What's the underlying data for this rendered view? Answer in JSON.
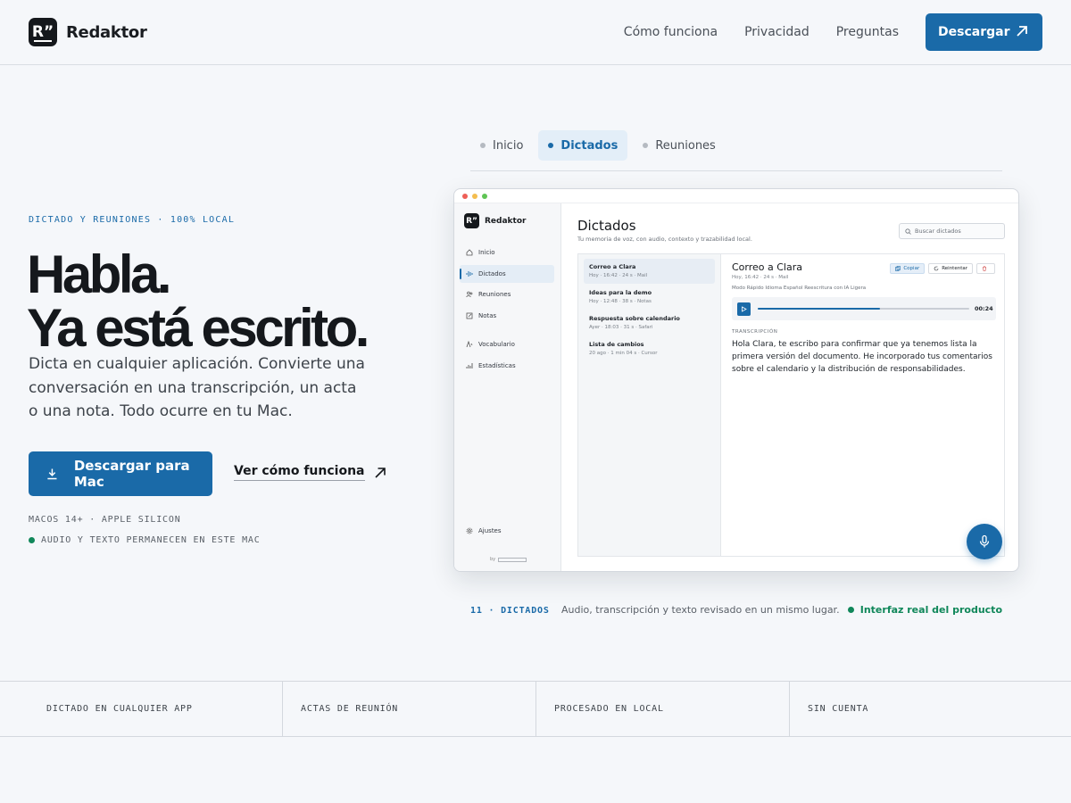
{
  "brand": {
    "name": "Redaktor",
    "mark": "R”"
  },
  "nav": {
    "links": [
      "Cómo funciona",
      "Privacidad",
      "Preguntas"
    ],
    "download_label": "Descargar"
  },
  "hero": {
    "eyebrow": "DICTADO Y REUNIONES · 100% LOCAL",
    "headline_1": "Habla.",
    "headline_2": "Ya está escrito.",
    "lede": "Dicta en cualquier aplicación. Convierte una conversación en una transcripción, un acta o una nota. Todo ocurre en tu Mac.",
    "cta_label": "Descargar para Mac",
    "secondary_label": "Ver cómo funciona",
    "meta_1": "MACOS 14+ · APPLE SILICON",
    "meta_2": "AUDIO Y TEXTO PERMANECEN EN ESTE MAC"
  },
  "tabs": [
    {
      "label": "Inicio",
      "active": false
    },
    {
      "label": "Dictados",
      "active": true
    },
    {
      "label": "Reuniones",
      "active": false
    }
  ],
  "app": {
    "brand": "Redaktor",
    "sidebar": {
      "items": [
        {
          "label": "Inicio",
          "icon": "home-icon"
        },
        {
          "label": "Dictados",
          "icon": "waveform-icon",
          "active": true
        },
        {
          "label": "Reuniones",
          "icon": "people-icon"
        },
        {
          "label": "Notas",
          "icon": "note-icon"
        },
        {
          "label": "Vocabulario",
          "icon": "vocabulary-icon"
        },
        {
          "label": "Estadísticas",
          "icon": "stats-icon"
        }
      ],
      "settings_label": "Ajustes",
      "by_label": "by"
    },
    "main": {
      "title": "Dictados",
      "subtitle": "Tu memoria de voz, con audio, contexto y trazabilidad local.",
      "search_placeholder": "Buscar dictados"
    },
    "list": [
      {
        "title": "Correo a Clara",
        "meta": "Hoy · 16:42 · 24 s · Mail",
        "active": true
      },
      {
        "title": "Ideas para la demo",
        "meta": "Hoy · 12:48 · 38 s · Notas"
      },
      {
        "title": "Respuesta sobre calendario",
        "meta": "Ayer · 18:03 · 31 s · Safari"
      },
      {
        "title": "Lista de cambios",
        "meta": "20 ago · 1 min 04 s · Cursor"
      }
    ],
    "detail": {
      "title": "Correo a Clara",
      "meta": "Hoy, 16:42 · 24 s · Mail",
      "copy_label": "Copiar",
      "retry_label": "Reintentar",
      "mode_text": "Modo  Rápido    Idioma  Español    Reescritura con IA  Ligera",
      "time": "00:24",
      "progress": 0.58,
      "transcript_label": "TRANSCRIPCIÓN",
      "transcript": "Hola Clara, te escribo para confirmar que ya tenemos lista la primera versión del documento. He incorporado tus comentarios sobre el calendario y la distribución de responsabilidades."
    }
  },
  "caption": {
    "count": "11 · DICTADOS",
    "text": "Audio, transcripción y texto revisado en un mismo lugar.",
    "real": "Interfaz real del producto"
  },
  "features": [
    "DICTADO EN CUALQUIER APP",
    "ACTAS DE REUNIÓN",
    "PROCESADO EN LOCAL",
    "SIN CUENTA"
  ],
  "colors": {
    "accent": "#1a6aa8",
    "success": "#10875a",
    "background": "#f5f7fa"
  }
}
